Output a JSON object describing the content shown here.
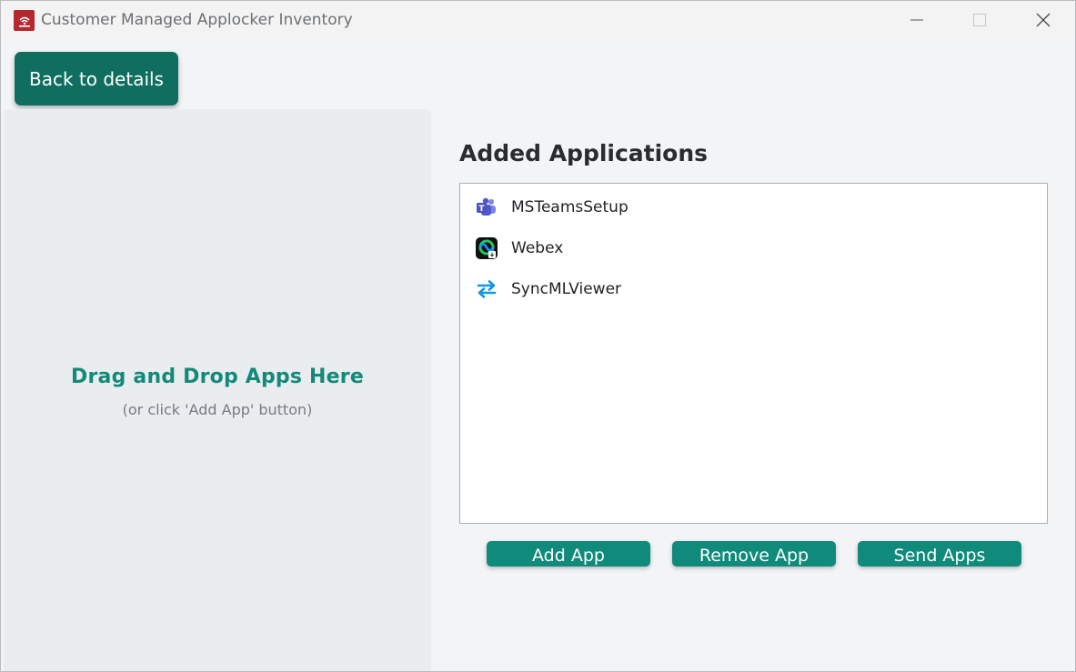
{
  "window": {
    "title": "Customer Managed Applocker Inventory",
    "icon": "app-logo-icon",
    "controls": [
      "minimize-icon",
      "maximize-icon",
      "close-icon"
    ]
  },
  "toolbar": {
    "back_label": "Back to details"
  },
  "drop_zone": {
    "title": "Drag and Drop Apps Here",
    "subtitle": "(or click 'Add App' button)"
  },
  "added_apps": {
    "heading": "Added Applications",
    "items": [
      {
        "label": "MSTeamsSetup",
        "icon": "teams-icon"
      },
      {
        "label": "Webex",
        "icon": "webex-icon"
      },
      {
        "label": "SyncMLViewer",
        "icon": "sync-arrows-icon"
      }
    ]
  },
  "actions": {
    "add_label": "Add App",
    "remove_label": "Remove App",
    "send_label": "Send Apps"
  },
  "colors": {
    "accent_dark": "#0f6e60",
    "accent": "#0f8a7b",
    "drop_title": "#13897a",
    "brand_red": "#b3292f"
  }
}
